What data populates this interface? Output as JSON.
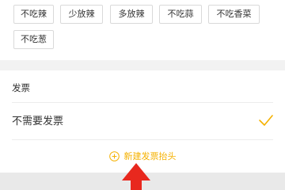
{
  "taste_tags": [
    "不吃辣",
    "少放辣",
    "多放辣",
    "不吃蒜",
    "不吃香菜",
    "不吃葱"
  ],
  "invoice": {
    "section_title": "发票",
    "option_label": "不需要发票",
    "new_header_label": "新建发票抬头"
  },
  "colors": {
    "accent": "#f5b100",
    "arrow": "#e8281e",
    "separator": "#f2f2f2"
  },
  "icons": {
    "check": "check-icon",
    "add": "plus-circle-icon",
    "pointer": "red-arrow-icon"
  }
}
